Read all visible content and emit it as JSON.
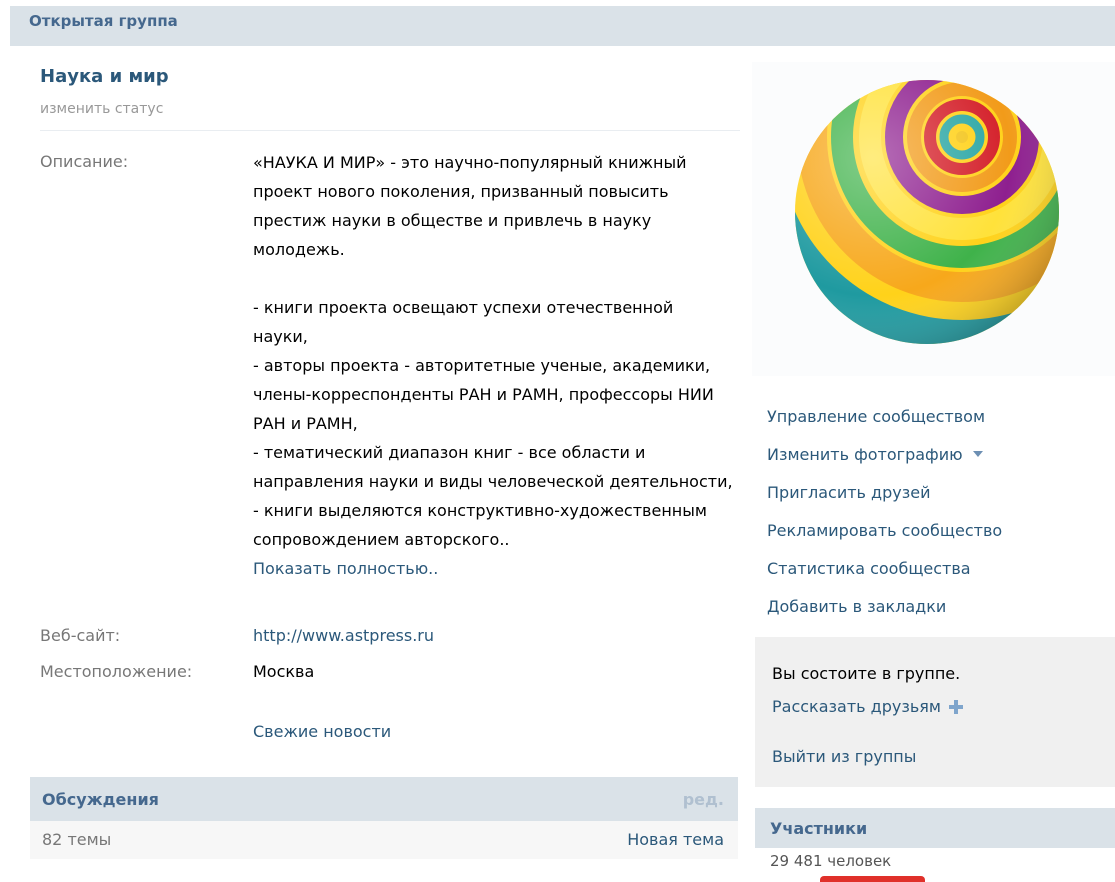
{
  "header": {
    "title": "Открытая группа"
  },
  "group": {
    "name": "Наука и мир",
    "status_link": "изменить статус"
  },
  "info": {
    "description_label": "Описание:",
    "description_paragraphs": [
      "«НАУКА И МИР» - это научно-популярный книжный проект нового поколения, призванный повысить престиж науки в обществе и привлечь в науку молодежь.",
      "",
      "- книги проекта освещают успехи отечественной науки,",
      "- авторы проекта - авторитетные ученые, академики, члены-корреспонденты РАН и РАМН, профессоры НИИ РАН и РАМН,",
      "- тематический диапазон книг - все области и направления науки и виды человеческой деятельности,",
      "- книги выделяются конструктивно-художественным сопровождением авторского.."
    ],
    "show_more": "Показать полностью..",
    "website_label": "Веб-сайт:",
    "website_value": "http://www.astpress.ru",
    "location_label": "Местоположение:",
    "location_value": "Москва",
    "news_link": "Свежие новости"
  },
  "actions": [
    "Управление сообществом",
    "Изменить фотографию",
    "Пригласить друзей",
    "Рекламировать сообщество",
    "Статистика сообщества",
    "Добавить в закладки"
  ],
  "membership": {
    "state": "Вы состоите в группе.",
    "tell_friends": "Рассказать друзьям",
    "leave": "Выйти из группы"
  },
  "discussions": {
    "title": "Обсуждения",
    "edit": "ред.",
    "count": "82 темы",
    "new_topic": "Новая тема"
  },
  "participants": {
    "title": "Участники",
    "count": "29 481 человек"
  },
  "colors": {
    "header_bg": "#dae2e8",
    "link": "#2b587a",
    "title": "#45688e"
  }
}
